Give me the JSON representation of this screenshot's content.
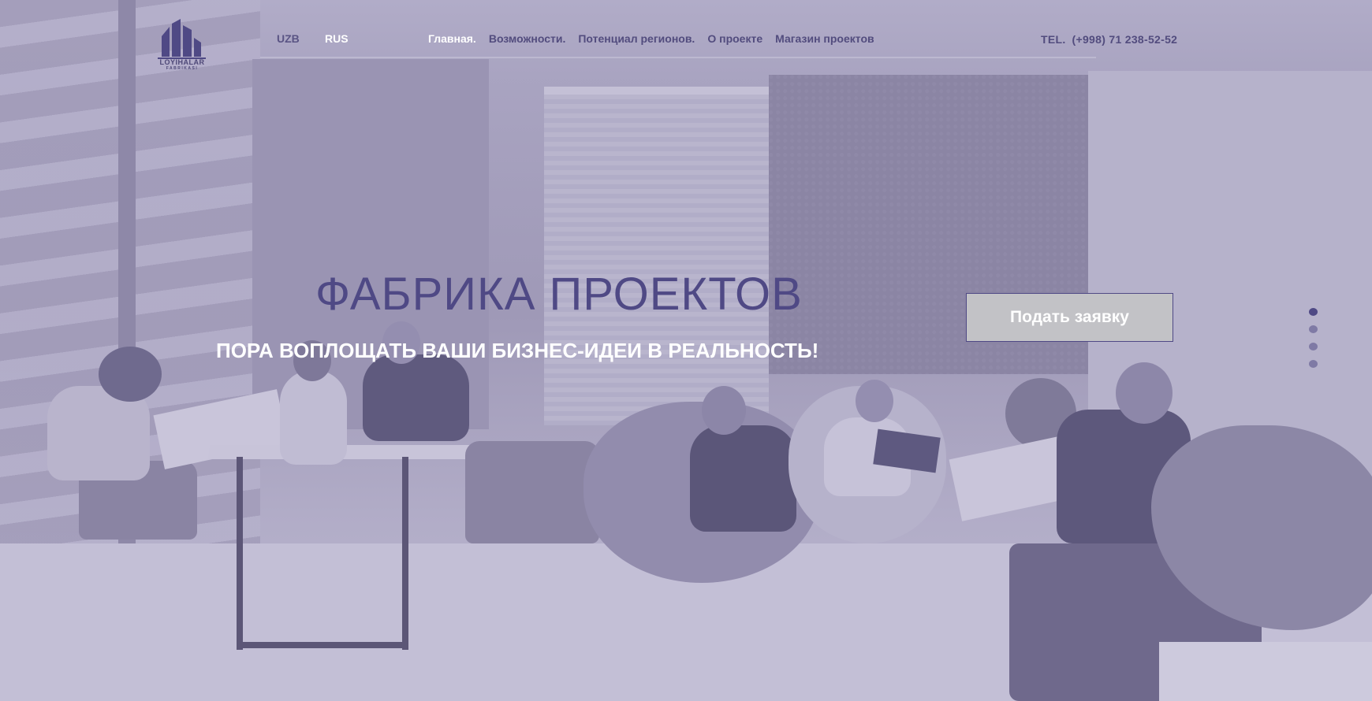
{
  "header": {
    "logo": {
      "icon": "buildings-logo-icon",
      "name": "LOYIHALAR",
      "sub": "FABRIKASI"
    },
    "languages": [
      {
        "label": "UZB",
        "active": false
      },
      {
        "label": "RUS",
        "active": true
      }
    ],
    "nav": [
      {
        "label": "Главная.",
        "active": true
      },
      {
        "label": "Возможности.",
        "active": false
      },
      {
        "label": "Потенциал регионов.",
        "active": false
      },
      {
        "label": "О проекте",
        "active": false
      },
      {
        "label": "Магазин проектов",
        "active": false
      }
    ],
    "phone": {
      "prefix": "TEL.",
      "number": "(+998)  71 238-52-52"
    }
  },
  "hero": {
    "title": "ФАБРИКА ПРОЕКТОВ",
    "subtitle": "ПОРА ВОПЛОЩАТЬ ВАШИ БИЗНЕС-ИДЕИ В РЕАЛЬНОСТЬ!",
    "cta_label": "Подать заявку"
  },
  "slider": {
    "total": 4,
    "active_index": 0
  },
  "colors": {
    "accent": "#4f4985",
    "overlay": "#a8a3bf",
    "button_bg": "#c2c2c6",
    "text_light": "#ffffff"
  }
}
